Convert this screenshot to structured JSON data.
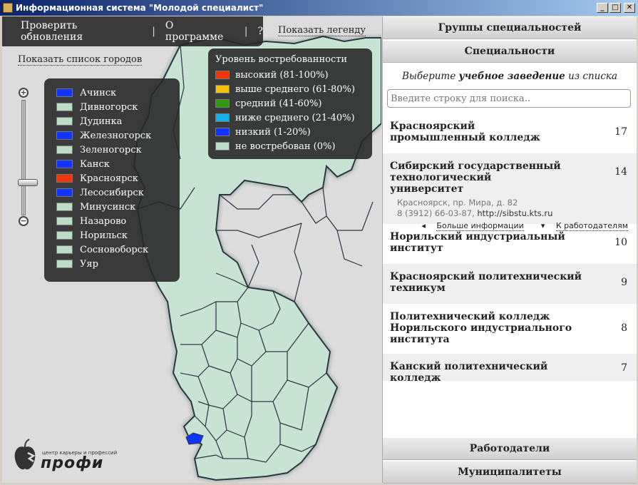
{
  "window": {
    "title": "Информационная система \"Молодой специалист\"",
    "minimize": "_",
    "maximize": "□",
    "close": "✕"
  },
  "topbar": {
    "check_updates": "Проверить обновления",
    "about": "О программе",
    "help": "?"
  },
  "map": {
    "show_legend": "Показать легенду",
    "show_cities": "Показать список городов",
    "zoom_in": "+",
    "zoom_out": "−"
  },
  "cities": [
    {
      "name": "Ачинск",
      "color": "#1033ff"
    },
    {
      "name": "Дивногорск",
      "color": "#bcdcc8"
    },
    {
      "name": "Дудинка",
      "color": "#bcdcc8"
    },
    {
      "name": "Железногорск",
      "color": "#1033ff"
    },
    {
      "name": "Зеленогорск",
      "color": "#bcdcc8"
    },
    {
      "name": "Канск",
      "color": "#1033ff"
    },
    {
      "name": "Красноярск",
      "color": "#f0360c"
    },
    {
      "name": "Лесосибирск",
      "color": "#1033ff"
    },
    {
      "name": "Минусинск",
      "color": "#bcdcc8"
    },
    {
      "name": "Назарово",
      "color": "#bcdcc8"
    },
    {
      "name": "Норильск",
      "color": "#bcdcc8"
    },
    {
      "name": "Сосновоборск",
      "color": "#bcdcc8"
    },
    {
      "name": "Уяр",
      "color": "#bcdcc8"
    }
  ],
  "legend": {
    "title": "Уровень востребованности",
    "items": [
      {
        "label": "высокий (81-100%)",
        "color": "#f0360c"
      },
      {
        "label": "выше среднего (61-80%)",
        "color": "#f5c20a"
      },
      {
        "label": "средний (41-60%)",
        "color": "#2f9a10"
      },
      {
        "label": "ниже среднего (21-40%)",
        "color": "#12b0e8"
      },
      {
        "label": "низкий (1-20%)",
        "color": "#1033ff"
      },
      {
        "label": "не востребован (0%)",
        "color": "#bcdcc8"
      }
    ]
  },
  "logo": {
    "tagline": "центр карьеры и профессий",
    "name": "профи"
  },
  "sections": {
    "groups": "Группы специальностей",
    "specialties": "Специальности",
    "employers": "Работодатели",
    "municipalities": "Муниципалитеты"
  },
  "specialties_panel": {
    "hint_pre": "Выберите ",
    "hint_bold": "учебное заведение",
    "hint_post": " из списка",
    "search_placeholder": "Введите строку для поиска..",
    "institutions": [
      {
        "name": "Красноярский промышленный колледж",
        "count": "17"
      },
      {
        "name": "Сибирский государственный технологический университет",
        "count": "14",
        "address": "Красноярск, пр. Мира, д. 82",
        "phone": "8 (3912) 66-03-87, ",
        "url": "http://sibstu.kts.ru",
        "more_info": "Больше информации",
        "to_employers": "К работодателям"
      },
      {
        "name": "Норильский индустриальный институт",
        "count": "10"
      },
      {
        "name": "Красноярский политехнический техникум",
        "count": "9"
      },
      {
        "name": "Политехнический колледж Норильского индустриального института",
        "count": "8"
      },
      {
        "name": "Канский политехнический колледж",
        "count": "7"
      }
    ]
  }
}
